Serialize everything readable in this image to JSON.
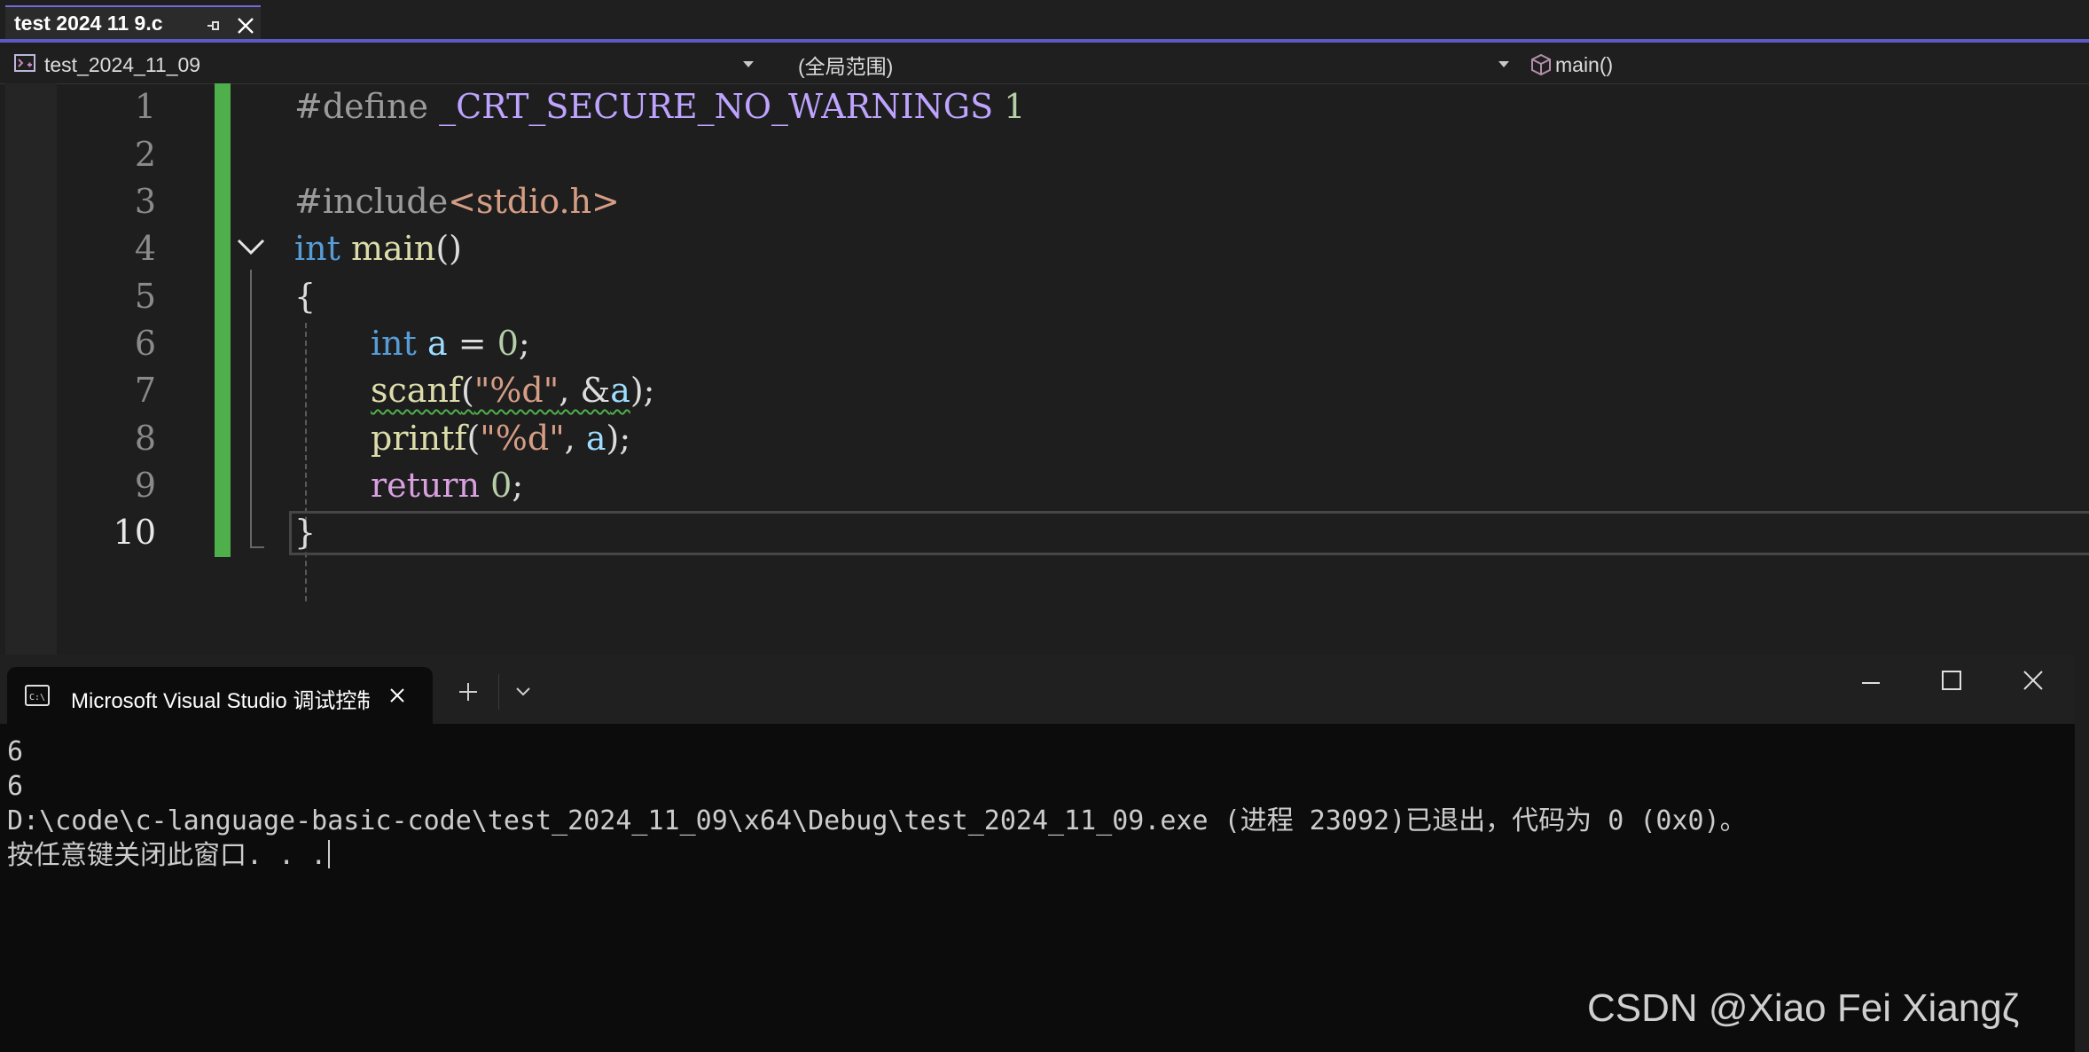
{
  "editor": {
    "tab": {
      "title": "test 2024 11 9.c"
    },
    "navbar": {
      "project": "test_2024_11_09",
      "scope": "(全局范围)",
      "member": "main()"
    },
    "line_numbers": [
      "1",
      "2",
      "3",
      "4",
      "5",
      "6",
      "7",
      "8",
      "9",
      "10"
    ],
    "code": {
      "line1": {
        "directive": "#define",
        "macro": "_CRT_SECURE_NO_WARNINGS",
        "value": "1"
      },
      "line3": {
        "directive": "#include",
        "header": "<stdio.h>"
      },
      "line4": {
        "type": "int",
        "name": "main",
        "parens": "()"
      },
      "line5": {
        "brace": "{"
      },
      "line6": {
        "type": "int",
        "var": "a",
        "op": "=",
        "value": "0",
        "end": ";"
      },
      "line7": {
        "fn": "scanf",
        "open": "(",
        "fmt": "\"%d\"",
        "sep": ", &",
        "arg": "a",
        "close": ");"
      },
      "line8": {
        "fn": "printf",
        "open": "(",
        "fmt": "\"%d\"",
        "sep": ", ",
        "arg": "a",
        "close": ");"
      },
      "line9": {
        "kw": "return",
        "value": "0",
        "end": ";"
      },
      "line10": {
        "brace": "}"
      }
    }
  },
  "terminal": {
    "tab_title": "Microsoft Visual Studio 调试控制台",
    "output": [
      "6",
      "6",
      "D:\\code\\c-language-basic-code\\test_2024_11_09\\x64\\Debug\\test_2024_11_09.exe (进程 23092)已退出，代码为 0 (0x0)。",
      "按任意键关闭此窗口. . ."
    ]
  },
  "watermark": "CSDN @Xiao Fei Xiangζ"
}
